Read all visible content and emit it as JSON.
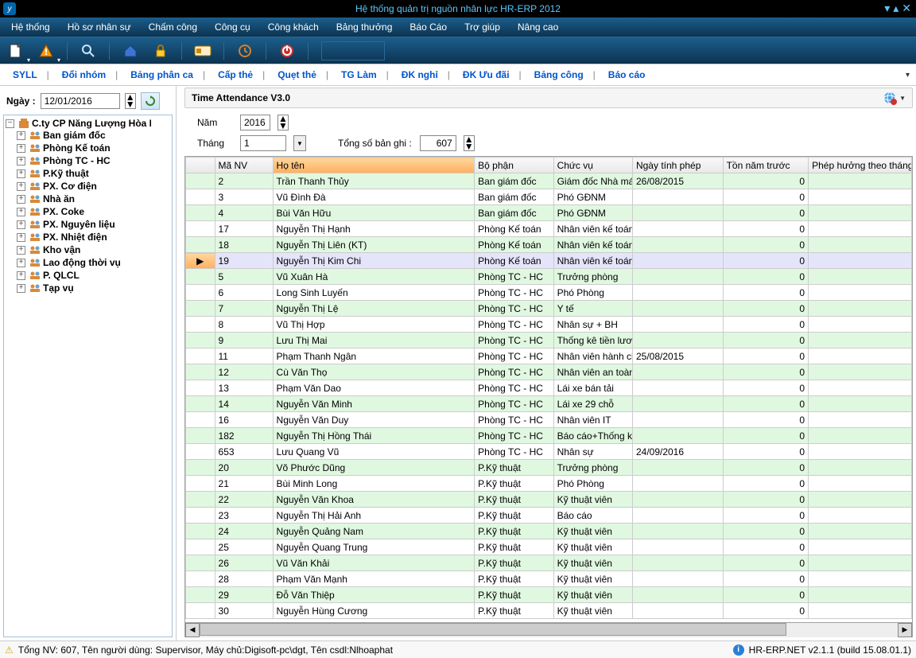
{
  "window": {
    "title": "Hệ thống quản trị nguồn nhân lực HR-ERP 2012"
  },
  "menu": [
    "Hệ thống",
    "Hồ sơ nhân sự",
    "Chấm công",
    "Công cụ",
    "Công khách",
    "Bảng thưởng",
    "Báo Cáo",
    "Trợ giúp",
    "Nâng cao"
  ],
  "subTabs": [
    "SYLL",
    "Đổi nhóm",
    "Bảng phân ca",
    "Cấp thẻ",
    "Quẹt thẻ",
    "TG Làm",
    "ĐK nghỉ",
    "ĐK Ưu đãi",
    "Bảng công",
    "Báo cáo"
  ],
  "date": {
    "label": "Ngày :",
    "value": "12/01/2016"
  },
  "tree": {
    "root": "C.ty CP Năng Lượng Hòa Phát",
    "children": [
      "Ban giám đốc",
      "Phòng Kế toán",
      "Phòng TC - HC",
      "P.Kỹ thuật",
      "PX. Cơ điện",
      "Nhà ăn",
      "PX. Coke",
      "PX. Nguyên liệu",
      "PX. Nhiệt điện",
      "Kho vận",
      "Lao động thời vụ",
      "P. QLCL",
      "Tạp vụ"
    ]
  },
  "panel": {
    "title": "Time Attendance V3.0",
    "yearLabel": "Năm",
    "year": "2016",
    "monthLabel": "Tháng",
    "month": "1",
    "totalLabel": "Tổng số bản ghi :",
    "total": "607"
  },
  "columns": [
    "",
    "Mã NV",
    "Họ tên",
    "Bộ phận",
    "Chức vụ",
    "Ngày tính phép",
    "Tồn năm trước",
    "Phép hưởng theo tháng"
  ],
  "rows": [
    {
      "ma": "2",
      "ten": "Trần Thanh Thủy",
      "bp": "Ban giám đốc",
      "cv": "Giám đốc Nhà máy",
      "np": "26/08/2015",
      "ton": "0"
    },
    {
      "ma": "3",
      "ten": "Vũ Đình Đà",
      "bp": "Ban giám đốc",
      "cv": "Phó GĐNM",
      "np": "",
      "ton": "0"
    },
    {
      "ma": "4",
      "ten": "Bùi Văn Hữu",
      "bp": "Ban giám đốc",
      "cv": "Phó GĐNM",
      "np": "",
      "ton": "0"
    },
    {
      "ma": "17",
      "ten": "Nguyễn Thị Hạnh",
      "bp": "Phòng Kế toán",
      "cv": "Nhân viên kế toán",
      "np": "",
      "ton": "0"
    },
    {
      "ma": "18",
      "ten": "Nguyễn Thị Liên (KT)",
      "bp": "Phòng Kế toán",
      "cv": "Nhân viên kế toán",
      "np": "",
      "ton": "0"
    },
    {
      "sel": true,
      "ma": "19",
      "ten": "Nguyễn Thị Kim Chi",
      "bp": "Phòng Kế toán",
      "cv": "Nhân viên kế toán",
      "np": "",
      "ton": "0"
    },
    {
      "ma": "5",
      "ten": "Vũ Xuân Hà",
      "bp": "Phòng TC - HC",
      "cv": "Trưởng phòng",
      "np": "",
      "ton": "0"
    },
    {
      "ma": "6",
      "ten": "Long Sinh Luyến",
      "bp": "Phòng TC - HC",
      "cv": "Phó Phòng",
      "np": "",
      "ton": "0"
    },
    {
      "ma": "7",
      "ten": "Nguyễn Thị Lệ",
      "bp": "Phòng TC - HC",
      "cv": "Y tế",
      "np": "",
      "ton": "0"
    },
    {
      "ma": "8",
      "ten": "Vũ Thị Hợp",
      "bp": "Phòng TC - HC",
      "cv": "Nhân sự + BH",
      "np": "",
      "ton": "0"
    },
    {
      "ma": "9",
      "ten": "Lưu Thị Mai",
      "bp": "Phòng TC - HC",
      "cv": "Thống kê tiền lương",
      "np": "",
      "ton": "0"
    },
    {
      "ma": "11",
      "ten": "Phạm Thanh Ngân",
      "bp": "Phòng TC - HC",
      "cv": "Nhân viên hành chính",
      "np": "25/08/2015",
      "ton": "0"
    },
    {
      "ma": "12",
      "ten": "Cù Văn Thọ",
      "bp": "Phòng TC - HC",
      "cv": "Nhân viên an toàn",
      "np": "",
      "ton": "0"
    },
    {
      "ma": "13",
      "ten": "Phạm Văn Dao",
      "bp": "Phòng TC - HC",
      "cv": "Lái xe bán tải",
      "np": "",
      "ton": "0"
    },
    {
      "ma": "14",
      "ten": "Nguyễn Văn Minh",
      "bp": "Phòng TC - HC",
      "cv": "Lái xe 29 chỗ",
      "np": "",
      "ton": "0"
    },
    {
      "ma": "16",
      "ten": "Nguyễn Văn Duy",
      "bp": "Phòng TC - HC",
      "cv": "Nhân viên IT",
      "np": "",
      "ton": "0"
    },
    {
      "ma": "182",
      "ten": "Nguyễn Thị Hồng Thái",
      "bp": "Phòng TC - HC",
      "cv": "Báo cáo+Thống kê",
      "np": "",
      "ton": "0"
    },
    {
      "ma": "653",
      "ten": "Lưu Quang Vũ",
      "bp": "Phòng TC - HC",
      "cv": "Nhân sự",
      "np": "24/09/2016",
      "ton": "0"
    },
    {
      "ma": "20",
      "ten": "Võ Phước Dũng",
      "bp": "P.Kỹ thuật",
      "cv": "Trưởng phòng",
      "np": "",
      "ton": "0"
    },
    {
      "ma": "21",
      "ten": "Bùi Minh Long",
      "bp": "P.Kỹ thuật",
      "cv": "Phó Phòng",
      "np": "",
      "ton": "0"
    },
    {
      "ma": "22",
      "ten": "Nguyễn Văn Khoa",
      "bp": "P.Kỹ thuật",
      "cv": "Kỹ thuật viên",
      "np": "",
      "ton": "0"
    },
    {
      "ma": "23",
      "ten": "Nguyễn Thị Hải Anh",
      "bp": "P.Kỹ thuật",
      "cv": "Báo cáo",
      "np": "",
      "ton": "0"
    },
    {
      "ma": "24",
      "ten": "Nguyễn Quảng Nam",
      "bp": "P.Kỹ thuật",
      "cv": "Kỹ thuật viên",
      "np": "",
      "ton": "0"
    },
    {
      "ma": "25",
      "ten": "Nguyễn Quang Trung",
      "bp": "P.Kỹ thuật",
      "cv": "Kỹ thuật viên",
      "np": "",
      "ton": "0"
    },
    {
      "ma": "26",
      "ten": "Vũ Văn Khải",
      "bp": "P.Kỹ thuật",
      "cv": "Kỹ thuật viên",
      "np": "",
      "ton": "0"
    },
    {
      "ma": "28",
      "ten": "Phạm Văn Mạnh",
      "bp": "P.Kỹ thuật",
      "cv": "Kỹ thuật viên",
      "np": "",
      "ton": "0"
    },
    {
      "ma": "29",
      "ten": "Đỗ Văn Thiệp",
      "bp": "P.Kỹ thuật",
      "cv": "Kỹ thuật viên",
      "np": "",
      "ton": "0"
    },
    {
      "ma": "30",
      "ten": "Nguyễn Hùng Cương",
      "bp": "P.Kỹ thuật",
      "cv": "Kỹ thuật viên",
      "np": "",
      "ton": "0"
    }
  ],
  "status": {
    "text": "Tổng NV: 607, Tên người dùng: Supervisor, Máy chủ:Digisoft-pc\\dgt, Tên csdl:Nlhoaphat",
    "version": "HR-ERP.NET v2.1.1 (build 15.08.01.1)"
  }
}
